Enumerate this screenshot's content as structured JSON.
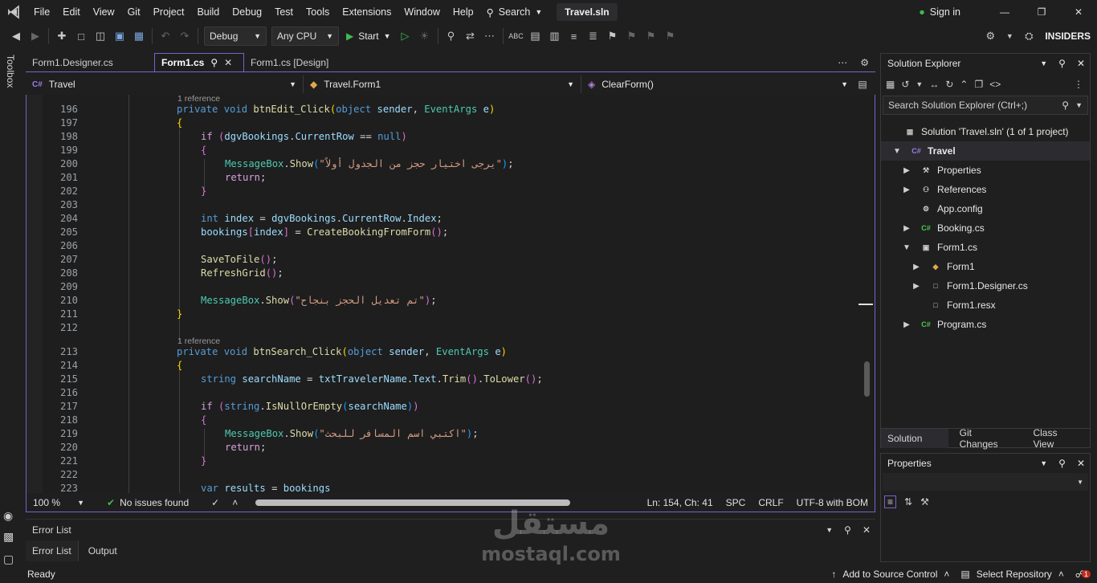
{
  "menu": {
    "items": [
      "File",
      "Edit",
      "View",
      "Git",
      "Project",
      "Build",
      "Debug",
      "Test",
      "Tools",
      "Extensions",
      "Window",
      "Help"
    ],
    "search": "Search",
    "solution_name": "Travel.sln",
    "sign_in": "Sign in"
  },
  "toolbar": {
    "config": "Debug",
    "platform": "Any CPU",
    "start": "Start",
    "insiders": "INSIDERS"
  },
  "toolbox_label": "Toolbox",
  "tabs": [
    {
      "label": "Form1.Designer.cs"
    },
    {
      "label": "Form1.cs"
    },
    {
      "label": "Form1.cs [Design]"
    }
  ],
  "navbar": {
    "project": "Travel",
    "class": "Travel.Form1",
    "member": "ClearForm()"
  },
  "code": {
    "refs": [
      "1 reference",
      "1 reference"
    ],
    "line_numbers": [
      "196",
      "197",
      "198",
      "199",
      "200",
      "201",
      "202",
      "203",
      "204",
      "205",
      "206",
      "207",
      "208",
      "209",
      "210",
      "211",
      "212",
      "213",
      "214",
      "215",
      "216",
      "217",
      "218",
      "219",
      "220",
      "221",
      "222",
      "223"
    ]
  },
  "status": {
    "zoom": "100 %",
    "issues": "No issues found",
    "position": "Ln: 154, Ch: 41",
    "spc": "SPC",
    "crlf": "CRLF",
    "encoding": "UTF-8 with BOM"
  },
  "error_list": {
    "title": "Error List",
    "tabs": [
      "Error List",
      "Output"
    ]
  },
  "solution_explorer": {
    "title": "Solution Explorer",
    "search_placeholder": "Search Solution Explorer (Ctrl+;)",
    "items": [
      {
        "label": "Solution 'Travel.sln' (1 of 1 project)"
      },
      {
        "label": "Travel"
      },
      {
        "label": "Properties"
      },
      {
        "label": "References"
      },
      {
        "label": "App.config"
      },
      {
        "label": "Booking.cs"
      },
      {
        "label": "Form1.cs"
      },
      {
        "label": "Form1"
      },
      {
        "label": "Form1.Designer.cs"
      },
      {
        "label": "Form1.resx"
      },
      {
        "label": "Program.cs"
      }
    ],
    "bottom_tabs": [
      "Solution Ex...",
      "Git Changes",
      "Class View"
    ]
  },
  "properties": {
    "title": "Properties"
  },
  "bottom": {
    "ready": "Ready",
    "add_source": "Add to Source Control",
    "select_repo": "Select Repository",
    "notif_count": "1"
  },
  "watermark": {
    "arabic": "مستقل",
    "latin": "mostaql.com"
  },
  "colors": {
    "accent": "#7a62c9",
    "keyword": "#569cd6",
    "type": "#4ec9b0",
    "method": "#dcdcaa",
    "string": "#d69d85"
  }
}
